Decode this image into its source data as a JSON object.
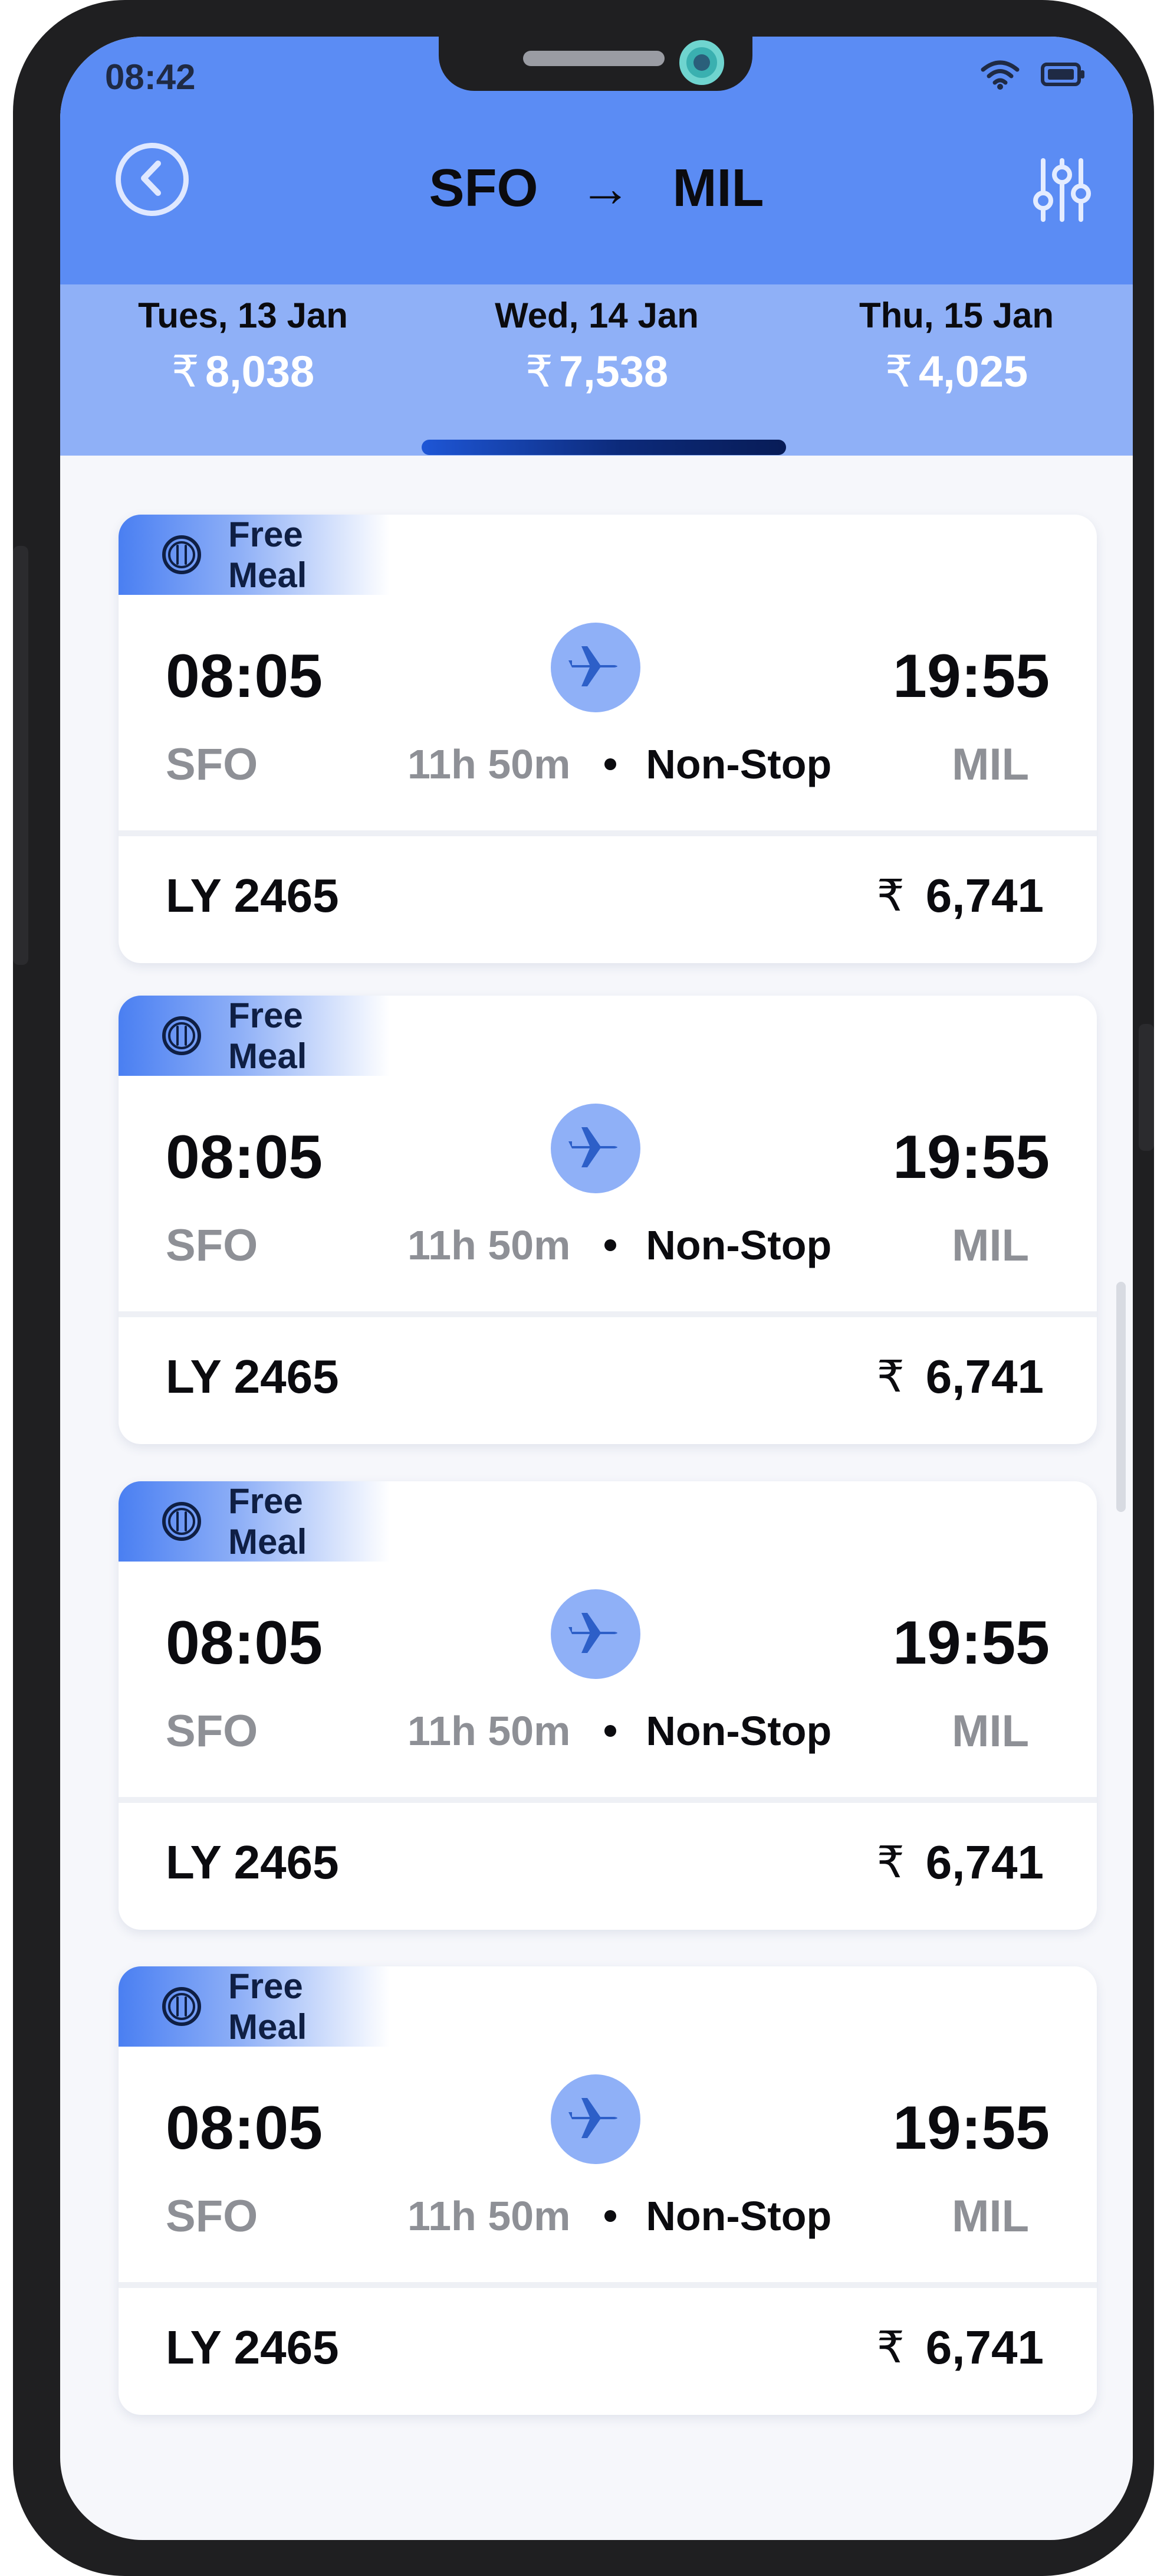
{
  "status_bar": {
    "time": "08:42",
    "icons": [
      "wifi-icon",
      "battery-icon"
    ]
  },
  "header": {
    "origin": "SFO",
    "arrow": "→",
    "destination": "MIL",
    "icons": [
      "back-chevron-icon",
      "filter-sliders-icon"
    ]
  },
  "date_strip": {
    "currency_symbol": "₹",
    "selected_index": 1,
    "dates": [
      {
        "date": "Tues, 13 Jan",
        "price": "8,038"
      },
      {
        "date": "Wed, 14 Jan",
        "price": "7,538"
      },
      {
        "date": "Thu, 15 Jan",
        "price": "4,025"
      }
    ]
  },
  "flights": [
    {
      "tag": "Free Meal",
      "depart_time": "08:05",
      "arrive_time": "19:55",
      "origin": "SFO",
      "destination": "MIL",
      "duration": "11h 50m",
      "stops": "Non-Stop",
      "flight_no": "LY 2465",
      "currency": "₹",
      "price": "6,741"
    },
    {
      "tag": "Free Meal",
      "depart_time": "08:05",
      "arrive_time": "19:55",
      "origin": "SFO",
      "destination": "MIL",
      "duration": "11h 50m",
      "stops": "Non-Stop",
      "flight_no": "LY 2465",
      "currency": "₹",
      "price": "6,741"
    },
    {
      "tag": "Free Meal",
      "depart_time": "08:05",
      "arrive_time": "19:55",
      "origin": "SFO",
      "destination": "MIL",
      "duration": "11h 50m",
      "stops": "Non-Stop",
      "flight_no": "LY 2465",
      "currency": "₹",
      "price": "6,741"
    },
    {
      "tag": "Free Meal",
      "depart_time": "08:05",
      "arrive_time": "19:55",
      "origin": "SFO",
      "destination": "MIL",
      "duration": "11h 50m",
      "stops": "Non-Stop",
      "flight_no": "LY 2465",
      "currency": "₹",
      "price": "6,741"
    }
  ],
  "colors": {
    "header_bg": "#5b8cf4",
    "date_strip_bg": "#8fb0f7",
    "active_indicator": "#0c2a7a",
    "card_bg": "#ffffff",
    "muted_text": "#8e9096"
  }
}
